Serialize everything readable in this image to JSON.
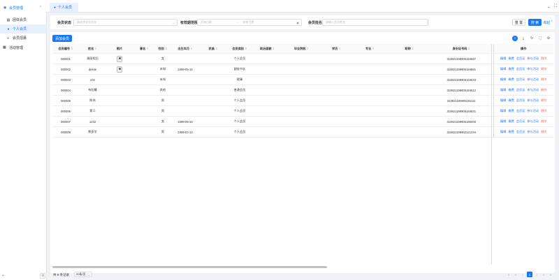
{
  "sidebar": {
    "parent_label": "会员管理",
    "items": [
      {
        "label": "团体会员",
        "icon": "group-icon"
      },
      {
        "label": "个人会员",
        "icon": "user-icon"
      },
      {
        "label": "会员招募",
        "icon": "recruit-icon"
      }
    ],
    "activity_label": "活动管理"
  },
  "tabbar": {
    "active_tab": "个人会员"
  },
  "filter": {
    "status_label": "会员状态",
    "status_placeholder": "请选择会员状态",
    "period_label": "有效期范围",
    "start_placeholder": "开始日期",
    "end_placeholder": "结束日期",
    "range_sep": "~",
    "name_label": "会员姓名",
    "name_placeholder": "请输入会员姓名",
    "reset_label": "重 置",
    "search_label": "搜 索",
    "collapse_label": "收起"
  },
  "main": {
    "add_label": "添加会员"
  },
  "table": {
    "columns": [
      "会员编号",
      "姓名",
      "照片",
      "曾名",
      "性别",
      "出生年月",
      "民族",
      "会员类别",
      "政治面貌",
      "毕业院校",
      "学历",
      "专业",
      "职称",
      "身份证号码",
      "操作"
    ],
    "rows": [
      [
        "000001",
        "谢丽熙巴",
        "",
        "",
        "女",
        "",
        "",
        "个人会员",
        "",
        "",
        "",
        "",
        "",
        "310821199905184687"
      ],
      [
        "000002",
        "delete",
        "",
        "",
        "未知",
        "1999-05-16",
        "",
        "副秘书长",
        "",
        "",
        "",
        "",
        "",
        "310821199905184681"
      ],
      [
        "000003",
        "c04",
        "",
        "",
        "未知",
        "",
        "",
        "理事",
        "",
        "",
        "",
        "",
        "",
        "310821199905184633"
      ],
      [
        "000004",
        "布阳雕",
        "",
        "",
        "其他",
        "",
        "",
        "普通会员",
        "",
        "",
        "",
        "",
        "",
        "310821199905184612"
      ],
      [
        "000005",
        "陈伟",
        "",
        "",
        "男",
        "",
        "",
        "个人会员",
        "",
        "",
        "",
        "",
        "",
        "310821199905181111"
      ],
      [
        "000006",
        "第二",
        "",
        "",
        "男",
        "",
        "",
        "个人会员",
        "",
        "",
        "",
        "",
        "",
        "310821199905184631"
      ],
      [
        "000007",
        "1232",
        "",
        "",
        "女",
        "1999-05-16",
        "",
        "个人会员",
        "",
        "",
        "",
        "",
        "",
        "310821199905180000"
      ],
      [
        "000008",
        "熊多学",
        "",
        "",
        "男",
        "1999-02-12",
        "",
        "个人会员",
        "",
        "",
        "",
        "",
        "",
        "310821199902121234"
      ]
    ],
    "row_photos": [
      true,
      true,
      false,
      false,
      false,
      false,
      false,
      false
    ],
    "actions": [
      "编辑",
      "缴费",
      "会员证",
      "参与活动",
      "删除"
    ]
  },
  "pager": {
    "total": "共 8 条记录",
    "size": "20条/页",
    "current": "1"
  }
}
